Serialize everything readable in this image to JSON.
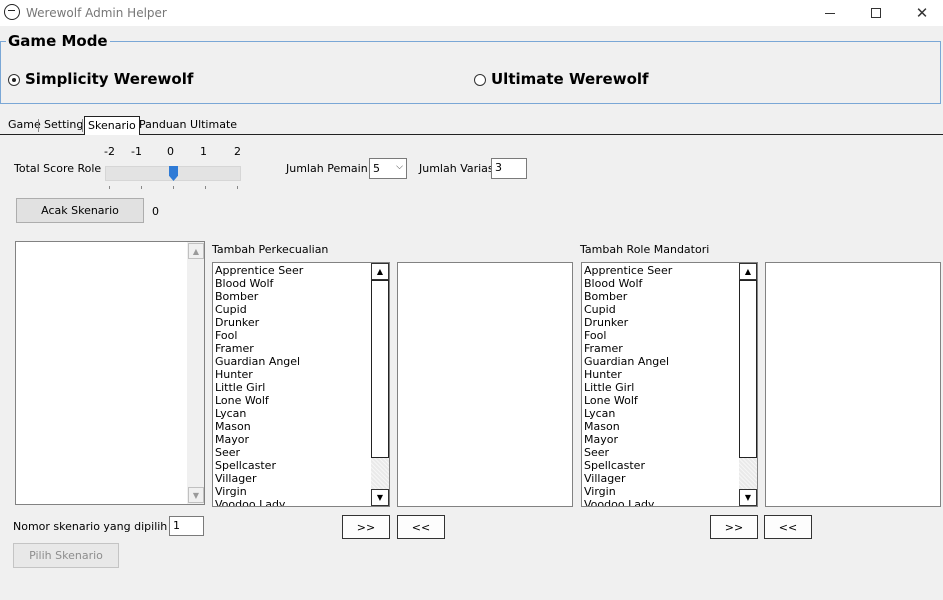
{
  "window": {
    "title": "Werewolf Admin Helper",
    "min_icon": "minimize-icon",
    "max_icon": "maximize-icon",
    "close_glyph": "✕"
  },
  "game_mode": {
    "legend": "Game Mode",
    "options": [
      {
        "label": "Simplicity Werewolf",
        "checked": true
      },
      {
        "label": "Ultimate Werewolf",
        "checked": false
      }
    ]
  },
  "tabs": [
    {
      "label": "Game",
      "active": false
    },
    {
      "label": "Setting",
      "active": false
    },
    {
      "label": "Skenario",
      "active": true
    },
    {
      "label": "Panduan Ultimate",
      "active": false
    }
  ],
  "skenario": {
    "total_score_label": "Total Score Role",
    "slider": {
      "ticks": [
        "-2",
        "-1",
        "0",
        "1",
        "2"
      ],
      "value": 0
    },
    "jumlah_pemain_label": "Jumlah Pemain",
    "jumlah_pemain_value": "5",
    "jumlah_variasi_label": "Jumlah Variasi",
    "jumlah_variasi_value": "3",
    "acak_button": "Acak Skenario",
    "acak_result": "0",
    "tambah_perkecualian_label": "Tambah Perkecualian",
    "tambah_mandatori_label": "Tambah Role Mandatori",
    "roles": [
      "Apprentice Seer",
      "Blood Wolf",
      "Bomber",
      "Cupid",
      "Drunker",
      "Fool",
      "Framer",
      "Guardian Angel",
      "Hunter",
      "Little Girl",
      "Lone Wolf",
      "Lycan",
      "Mason",
      "Mayor",
      "Seer",
      "Spellcaster",
      "Villager",
      "Virgin",
      "Voodoo Lady"
    ],
    "add_button": ">>",
    "remove_button": "<<",
    "nomor_label": "Nomor skenario yang dipilih",
    "nomor_value": "1",
    "pilih_button": "Pilih Skenario"
  },
  "colors": {
    "group_border": "#7aa7d6",
    "slider_thumb": "#2f7bd6",
    "window_bg": "#f0f0f0"
  }
}
